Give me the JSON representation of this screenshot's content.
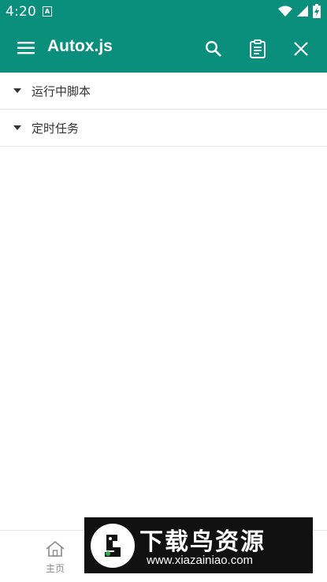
{
  "status_bar": {
    "time": "4:20",
    "notification_letter": "A",
    "icons": [
      "wifi-icon",
      "signal-icon",
      "battery-charging-icon"
    ]
  },
  "app_bar": {
    "title": "Autox.js",
    "background_color": "#0b8f7d",
    "actions": [
      "search-icon",
      "clipboard-icon",
      "close-icon"
    ]
  },
  "sections": [
    {
      "label": "运行中脚本"
    },
    {
      "label": "定时任务"
    }
  ],
  "bottom_nav": {
    "home_label": "主页"
  },
  "watermark": {
    "title": "下载鸟资源",
    "url": "www.xiazainiao.com"
  }
}
